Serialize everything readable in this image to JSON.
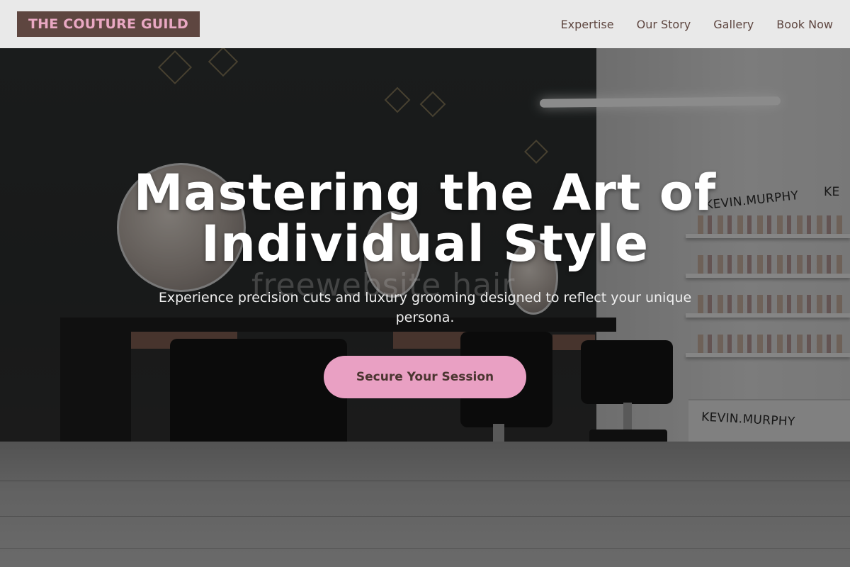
{
  "header": {
    "logo": "THE COUTURE GUILD",
    "nav": [
      {
        "label": "Expertise"
      },
      {
        "label": "Our Story"
      },
      {
        "label": "Gallery"
      },
      {
        "label": "Book Now"
      }
    ]
  },
  "hero": {
    "title_line1": "Mastering the Art of",
    "title_line2": "Individual Style",
    "subtitle": "Experience precision cuts and luxury grooming designed to reflect your unique persona.",
    "cta_label": "Secure Your Session",
    "watermark": "freewebsite hair",
    "brand_text_1": "KEVIN.MURPHY",
    "brand_text_2": "KEVIN.MURPHY",
    "brand_text_3": "KE"
  },
  "colors": {
    "header_bg": "#e9e9e9",
    "logo_bg": "#5e4640",
    "logo_text": "#e9a8c3",
    "nav_text": "#5e4640",
    "cta_bg": "#e9a0c3",
    "cta_text": "#4a3530"
  }
}
